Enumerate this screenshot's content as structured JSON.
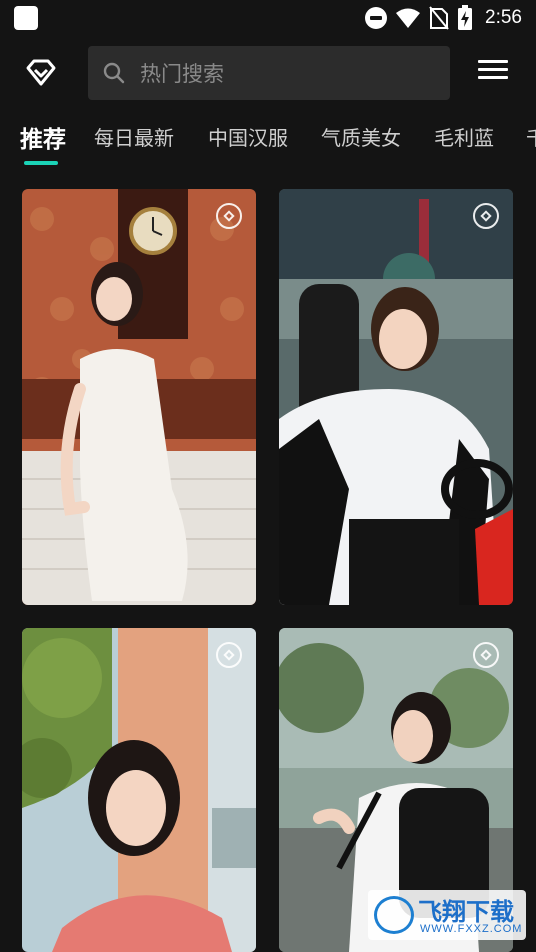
{
  "status_bar": {
    "time": "2:56",
    "icons": [
      "app-icon",
      "dnd-icon",
      "wifi-icon",
      "no-sim-icon",
      "battery-charging-icon"
    ]
  },
  "header": {
    "logo_icon": "diamond-logo-icon",
    "search": {
      "placeholder": "热门搜索",
      "icon": "search-icon"
    },
    "menu_icon": "hamburger-menu-icon"
  },
  "tabs": [
    {
      "label": "推荐",
      "active": true
    },
    {
      "label": "每日最新",
      "active": false
    },
    {
      "label": "中国汉服",
      "active": false
    },
    {
      "label": "气质美女",
      "active": false
    },
    {
      "label": "毛利蓝",
      "active": false
    },
    {
      "label": "千",
      "active": false
    }
  ],
  "accent_color": "#1bd3b7",
  "cards": [
    {
      "subject": "woman in white qipao beside wall clock",
      "badge_icon": "diamond-badge-icon"
    },
    {
      "subject": "woman in racing jacket sitting in go-kart",
      "badge_icon": "diamond-badge-icon"
    },
    {
      "subject": "woman in pink sweater by pillar",
      "badge_icon": "diamond-badge-icon"
    },
    {
      "subject": "student with ponytail and black backpack",
      "badge_icon": "diamond-badge-icon"
    }
  ],
  "watermark": {
    "text": "飞翔下载",
    "url": "WWW.FXXZ.COM"
  }
}
